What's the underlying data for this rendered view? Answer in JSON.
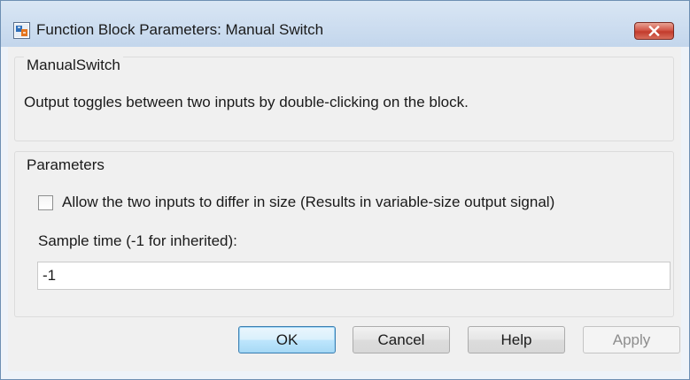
{
  "window": {
    "title": "Function Block Parameters: Manual Switch",
    "icon": "simulink-block-icon",
    "close_icon": "close-icon"
  },
  "description": {
    "group_title": "ManualSwitch",
    "text": "Output toggles between two inputs by double-clicking on the block."
  },
  "parameters": {
    "group_title": "Parameters",
    "allow_differ_label": "Allow the two inputs to differ in size (Results in variable-size output signal)",
    "allow_differ_checked": false,
    "sample_time_label": "Sample time (-1 for inherited):",
    "sample_time_value": "-1"
  },
  "buttons": {
    "ok": "OK",
    "cancel": "Cancel",
    "help": "Help",
    "apply": "Apply",
    "apply_enabled": false
  },
  "colors": {
    "title_bar": "#c8daee",
    "close_button": "#c9473a",
    "default_button_border": "#3c7fb1"
  }
}
